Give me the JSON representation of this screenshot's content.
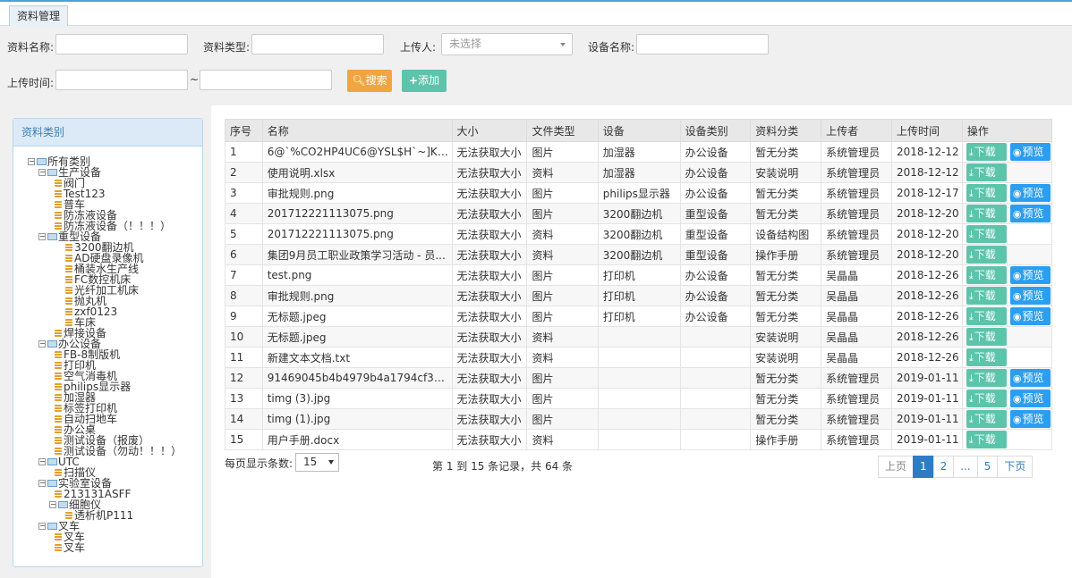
{
  "tab": "资料管理",
  "filters": {
    "name_label": "资料名称:",
    "type_label": "资料类型:",
    "uploader_label": "上传人:",
    "uploader_placeholder": "未选择",
    "device_label": "设备名称:",
    "time_label": "上传时间:",
    "tilde": "~",
    "search_label": "搜索",
    "add_label": "添加"
  },
  "tree": {
    "title": "资料类别",
    "nodes": [
      {
        "level": 0,
        "kind": "folder",
        "label": "所有类别"
      },
      {
        "level": 1,
        "kind": "folder",
        "label": "生产设备"
      },
      {
        "level": 2,
        "kind": "leaf",
        "label": "阀门"
      },
      {
        "level": 2,
        "kind": "leaf",
        "label": "Test123"
      },
      {
        "level": 2,
        "kind": "leaf",
        "label": "普车"
      },
      {
        "level": 2,
        "kind": "leaf",
        "label": "防冻液设备"
      },
      {
        "level": 2,
        "kind": "leaf",
        "label": "防冻液设备（！！！）"
      },
      {
        "level": 1,
        "kind": "folder",
        "label": "重型设备"
      },
      {
        "level": 3,
        "kind": "leaf",
        "label": "3200翻边机"
      },
      {
        "level": 3,
        "kind": "leaf",
        "label": "AD硬盘录像机"
      },
      {
        "level": 3,
        "kind": "leaf",
        "label": "桶装水生产线"
      },
      {
        "level": 3,
        "kind": "leaf",
        "label": "FC数控机床"
      },
      {
        "level": 3,
        "kind": "leaf",
        "label": "光纤加工机床"
      },
      {
        "level": 3,
        "kind": "leaf",
        "label": "抛丸机"
      },
      {
        "level": 3,
        "kind": "leaf",
        "label": "zxf0123"
      },
      {
        "level": 3,
        "kind": "leaf",
        "label": "车床"
      },
      {
        "level": 2,
        "kind": "leaf",
        "label": "焊接设备"
      },
      {
        "level": 1,
        "kind": "folder",
        "label": "办公设备"
      },
      {
        "level": 2,
        "kind": "leaf",
        "label": "FB-8制版机"
      },
      {
        "level": 2,
        "kind": "leaf",
        "label": "打印机"
      },
      {
        "level": 2,
        "kind": "leaf",
        "label": "空气消毒机"
      },
      {
        "level": 2,
        "kind": "leaf",
        "label": "philips显示器"
      },
      {
        "level": 2,
        "kind": "leaf",
        "label": "加湿器"
      },
      {
        "level": 2,
        "kind": "leaf",
        "label": "标签打印机"
      },
      {
        "level": 2,
        "kind": "leaf",
        "label": "自动扫地车"
      },
      {
        "level": 2,
        "kind": "leaf",
        "label": "办公桌"
      },
      {
        "level": 2,
        "kind": "leaf",
        "label": "测试设备（报废）"
      },
      {
        "level": 2,
        "kind": "leaf",
        "label": "测试设备（勿动！！！）"
      },
      {
        "level": 1,
        "kind": "folder",
        "label": "UTC"
      },
      {
        "level": 2,
        "kind": "leaf",
        "label": "扫描仪"
      },
      {
        "level": 1,
        "kind": "folder",
        "label": "实验室设备"
      },
      {
        "level": 2,
        "kind": "leaf",
        "label": "213131ASFF"
      },
      {
        "level": 2,
        "kind": "folder",
        "label": "细胞仪"
      },
      {
        "level": 3,
        "kind": "leaf",
        "label": "透析机P111"
      },
      {
        "level": 1,
        "kind": "folder",
        "label": "叉车"
      },
      {
        "level": 2,
        "kind": "leaf",
        "label": "叉车"
      },
      {
        "level": 2,
        "kind": "leaf",
        "label": "叉车"
      }
    ]
  },
  "table": {
    "headers": [
      "序号",
      "名称",
      "大小",
      "文件类型",
      "设备",
      "设备类别",
      "资料分类",
      "上传者",
      "上传时间",
      "操作"
    ],
    "download_label": "下载",
    "preview_label": "预览",
    "rows": [
      {
        "cells": [
          "1",
          "6@`%CO2HP4UC6@YSL$H`~]K.p...",
          "无法获取大小",
          "图片",
          "加湿器",
          "办公设备",
          "暂无分类",
          "系统管理员",
          "2018-12-12"
        ],
        "preview": true
      },
      {
        "cells": [
          "2",
          "使用说明.xlsx",
          "无法获取大小",
          "资料",
          "加湿器",
          "办公设备",
          "安装说明",
          "系统管理员",
          "2018-12-12"
        ],
        "preview": false
      },
      {
        "cells": [
          "3",
          "审批规则.png",
          "无法获取大小",
          "图片",
          "philips显示器",
          "办公设备",
          "暂无分类",
          "系统管理员",
          "2018-12-17"
        ],
        "preview": true
      },
      {
        "cells": [
          "4",
          "201712221113075.png",
          "无法获取大小",
          "图片",
          "3200翻边机",
          "重型设备",
          "暂无分类",
          "系统管理员",
          "2018-12-20"
        ],
        "preview": true
      },
      {
        "cells": [
          "5",
          "201712221113075.png",
          "无法获取大小",
          "资料",
          "3200翻边机",
          "重型设备",
          "设备结构图",
          "系统管理员",
          "2018-12-20"
        ],
        "preview": false
      },
      {
        "cells": [
          "6",
          "集团9月员工职业政策学习活动 - 员...",
          "无法获取大小",
          "资料",
          "3200翻边机",
          "重型设备",
          "操作手册",
          "系统管理员",
          "2018-12-20"
        ],
        "preview": false
      },
      {
        "cells": [
          "7",
          "test.png",
          "无法获取大小",
          "图片",
          "打印机",
          "办公设备",
          "暂无分类",
          "吴晶晶",
          "2018-12-26"
        ],
        "preview": true
      },
      {
        "cells": [
          "8",
          "审批规则.png",
          "无法获取大小",
          "图片",
          "打印机",
          "办公设备",
          "暂无分类",
          "吴晶晶",
          "2018-12-26"
        ],
        "preview": true
      },
      {
        "cells": [
          "9",
          "无标题.jpeg",
          "无法获取大小",
          "图片",
          "打印机",
          "办公设备",
          "暂无分类",
          "吴晶晶",
          "2018-12-26"
        ],
        "preview": true
      },
      {
        "cells": [
          "10",
          "无标题.jpeg",
          "无法获取大小",
          "资料",
          "",
          "",
          "安装说明",
          "吴晶晶",
          "2018-12-26"
        ],
        "preview": false
      },
      {
        "cells": [
          "11",
          "新建文本文档.txt",
          "无法获取大小",
          "资料",
          "",
          "",
          "安装说明",
          "吴晶晶",
          "2018-12-26"
        ],
        "preview": false
      },
      {
        "cells": [
          "12",
          "91469045b4b4979b4a1794cf33f...",
          "无法获取大小",
          "图片",
          "",
          "",
          "暂无分类",
          "系统管理员",
          "2019-01-11"
        ],
        "preview": true
      },
      {
        "cells": [
          "13",
          "timg (3).jpg",
          "无法获取大小",
          "图片",
          "",
          "",
          "暂无分类",
          "系统管理员",
          "2019-01-11"
        ],
        "preview": true
      },
      {
        "cells": [
          "14",
          "timg (1).jpg",
          "无法获取大小",
          "图片",
          "",
          "",
          "暂无分类",
          "系统管理员",
          "2019-01-11"
        ],
        "preview": true
      },
      {
        "cells": [
          "15",
          "用户手册.docx",
          "无法获取大小",
          "资料",
          "",
          "",
          "操作手册",
          "系统管理员",
          "2019-01-11"
        ],
        "preview": false
      }
    ]
  },
  "pagination": {
    "page_size_label": "每页显示条数:",
    "page_size": "15",
    "summary": "第 1 到 15 条记录，共 64 条",
    "prev": "上页",
    "pages": [
      "1",
      "2",
      "...",
      "5"
    ],
    "next": "下页"
  }
}
